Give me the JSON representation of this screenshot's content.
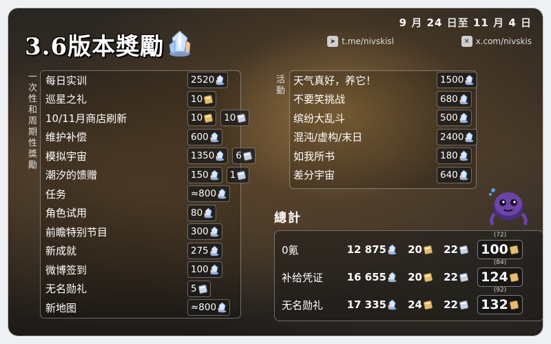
{
  "header": {
    "date_parts": [
      "9",
      "月",
      "24",
      "日至",
      "11",
      "月",
      "4",
      "日"
    ],
    "telegram": "t.me/nivskisl",
    "x_handle": "x.com/nivskis"
  },
  "title": "3.6版本獎勵",
  "left_section_label": "一次性和周期性獎勵",
  "right_section_label": "活動",
  "left_rows": [
    {
      "label": "每日实训",
      "rewards": [
        {
          "amount": "2520",
          "icon": "stellar-jade-icon"
        }
      ]
    },
    {
      "label": "巡星之礼",
      "rewards": [
        {
          "amount": "10",
          "icon": "star-rail-special-pass-icon"
        }
      ]
    },
    {
      "label": "10/11月商店刷新",
      "rewards": [
        {
          "amount": "10",
          "icon": "star-rail-special-pass-icon"
        },
        {
          "amount": "10",
          "icon": "star-rail-pass-icon"
        }
      ]
    },
    {
      "label": "维护补偿",
      "rewards": [
        {
          "amount": "600",
          "icon": "stellar-jade-icon"
        }
      ]
    },
    {
      "label": "模拟宇宙",
      "rewards": [
        {
          "amount": "1350",
          "icon": "stellar-jade-icon"
        },
        {
          "amount": "6",
          "icon": "star-rail-pass-icon"
        }
      ]
    },
    {
      "label": "潮汐的馈赠",
      "rewards": [
        {
          "amount": "150",
          "icon": "stellar-jade-icon"
        },
        {
          "amount": "1",
          "icon": "star-rail-pass-icon"
        }
      ]
    },
    {
      "label": "任务",
      "rewards": [
        {
          "amount": "≈800",
          "icon": "stellar-jade-icon"
        }
      ]
    },
    {
      "label": "角色试用",
      "rewards": [
        {
          "amount": "80",
          "icon": "stellar-jade-icon"
        }
      ]
    },
    {
      "label": "前瞻特别节目",
      "rewards": [
        {
          "amount": "300",
          "icon": "stellar-jade-icon"
        }
      ]
    },
    {
      "label": "新成就",
      "rewards": [
        {
          "amount": "275",
          "icon": "stellar-jade-icon"
        }
      ]
    },
    {
      "label": "微博签到",
      "rewards": [
        {
          "amount": "100",
          "icon": "stellar-jade-icon"
        }
      ]
    },
    {
      "label": "无名勋礼",
      "rewards": [
        {
          "amount": "5",
          "icon": "star-rail-pass-icon"
        }
      ]
    },
    {
      "label": "新地图",
      "rewards": [
        {
          "amount": "≈800",
          "icon": "stellar-jade-icon"
        }
      ]
    }
  ],
  "right_rows": [
    {
      "label": "天气真好，养它！",
      "rewards": [
        {
          "amount": "1500",
          "icon": "stellar-jade-icon"
        }
      ]
    },
    {
      "label": "不要笑挑战",
      "rewards": [
        {
          "amount": "680",
          "icon": "stellar-jade-icon"
        }
      ]
    },
    {
      "label": "缤纷大乱斗",
      "rewards": [
        {
          "amount": "500",
          "icon": "stellar-jade-icon"
        }
      ]
    },
    {
      "label": "混沌/虚构/末日",
      "rewards": [
        {
          "amount": "2400",
          "icon": "stellar-jade-icon"
        }
      ]
    },
    {
      "label": "如我所书",
      "rewards": [
        {
          "amount": "180",
          "icon": "stellar-jade-icon"
        }
      ]
    },
    {
      "label": "差分宇宙",
      "rewards": [
        {
          "amount": "640",
          "icon": "stellar-jade-icon"
        }
      ]
    }
  ],
  "totals": {
    "label": "總計",
    "rows": [
      {
        "label": "0氪",
        "jade": "12 875",
        "special_pass": "20",
        "pass": "22",
        "pulls_note": "(72)",
        "pulls": "100"
      },
      {
        "label": "补给凭证",
        "jade": "16 655",
        "special_pass": "20",
        "pass": "22",
        "pulls_note": "(84)",
        "pulls": "124"
      },
      {
        "label": "无名勋礼",
        "jade": "17 335",
        "special_pass": "24",
        "pass": "22",
        "pulls_note": "(92)",
        "pulls": "132"
      }
    ]
  },
  "colors": {
    "background": "#2e2822",
    "text": "#ffffff",
    "pill_bg": "#1f1f1f",
    "jade": "#a8c8f0",
    "special_pass": "#d9b56a",
    "pass": "#b9c4d6"
  }
}
